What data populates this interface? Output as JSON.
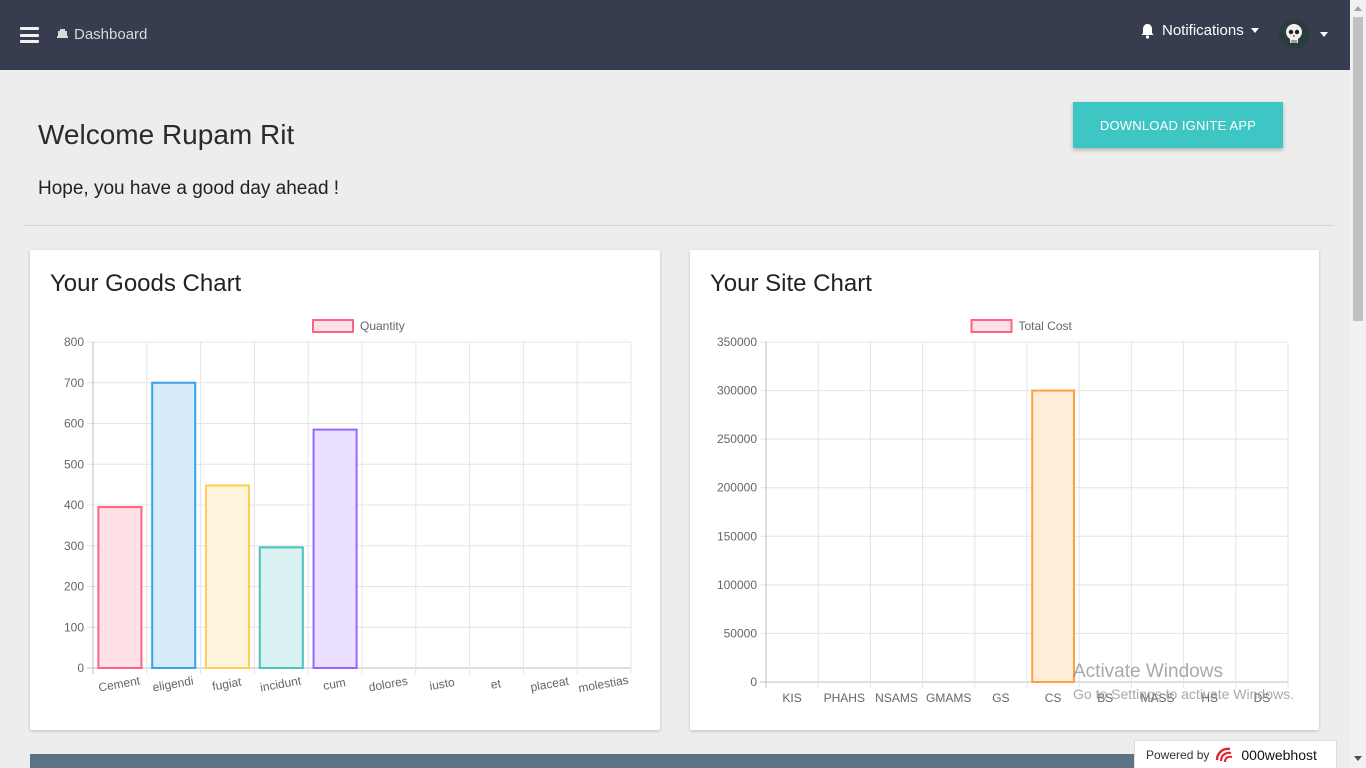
{
  "topbar": {
    "brand_label": "Dashboard",
    "notifications_label": "Notifications"
  },
  "welcome": {
    "title": "Welcome Rupam Rit",
    "subtitle": "Hope, you have a good day ahead !",
    "download_button": "DOWNLOAD IGNITE APP"
  },
  "goods_chart": {
    "heading": "Your Goods Chart",
    "chart_data": {
      "type": "bar",
      "categories": [
        "Cement",
        "eligendi",
        "fugiat",
        "incidunt",
        "cum",
        "dolores",
        "iusto",
        "et",
        "placeat",
        "molestias"
      ],
      "series": [
        {
          "name": "Quantity",
          "values": [
            395,
            700,
            448,
            296,
            585,
            0,
            0,
            0,
            0,
            0
          ]
        }
      ],
      "ylim": [
        0,
        800
      ],
      "yticks": [
        0,
        100,
        200,
        300,
        400,
        500,
        600,
        700,
        800
      ],
      "grid": true,
      "legend": "top",
      "bar_colors": [
        "#ff6384",
        "#36a2eb",
        "#ffce56",
        "#4bc0c0",
        "#9966ff"
      ],
      "bar_fills": [
        "#ffe0e6",
        "#d7ecfb",
        "#fff5dd",
        "#dbf2f2",
        "#ebe0ff"
      ],
      "legend_color": "#ff6384",
      "legend_fill": "#ffe0e6"
    }
  },
  "site_chart": {
    "heading": "Your Site Chart",
    "chart_data": {
      "type": "bar",
      "categories": [
        "KIS",
        "PHAHS",
        "NSAMS",
        "GMAMS",
        "GS",
        "CS",
        "BS",
        "MASS",
        "HS",
        "DS"
      ],
      "series": [
        {
          "name": "Total Cost",
          "values": [
            0,
            0,
            0,
            0,
            0,
            300000,
            0,
            0,
            0,
            0
          ]
        }
      ],
      "ylim": [
        0,
        350000
      ],
      "yticks": [
        0,
        50000,
        100000,
        150000,
        200000,
        250000,
        300000,
        350000
      ],
      "grid": true,
      "legend": "top",
      "bar_colors": [
        "#ff6384",
        "#36a2eb",
        "#ffce56",
        "#4bc0c0",
        "#9966ff",
        "#ff9f40",
        "#ff6384",
        "#36a2eb",
        "#ffce56",
        "#4bc0c0"
      ],
      "bar_fills": [
        "#ffe0e6",
        "#d7ecfb",
        "#fff5dd",
        "#dbf2f2",
        "#ebe0ff",
        "#ffecd9",
        "#ffe0e6",
        "#d7ecfb",
        "#fff5dd",
        "#dbf2f2"
      ],
      "legend_color": "#ff6384",
      "legend_fill": "#ffe0e6"
    }
  },
  "footer": {
    "powered_by": "Powered by",
    "host_name": "000webhost"
  },
  "overlay": {
    "activate_title": "Activate Windows",
    "activate_sub": "Go to Settings to activate Windows."
  }
}
